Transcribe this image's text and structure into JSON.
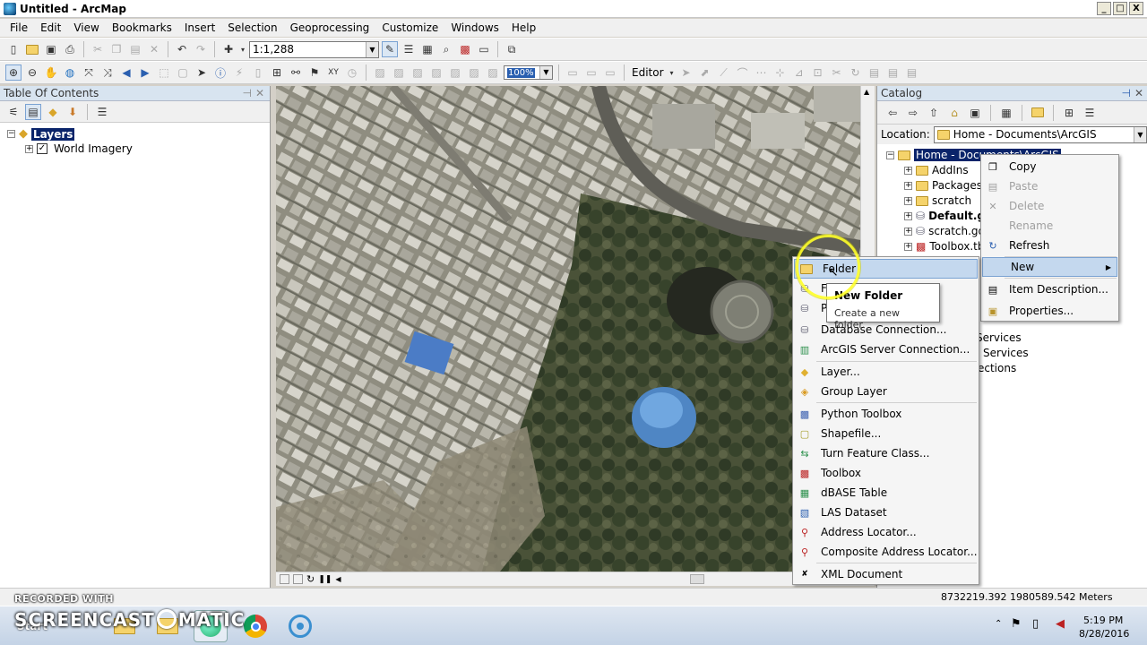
{
  "window": {
    "title": "Untitled - ArcMap",
    "min": "_",
    "max": "□",
    "close": "X"
  },
  "menu": [
    "File",
    "Edit",
    "View",
    "Bookmarks",
    "Insert",
    "Selection",
    "Geoprocessing",
    "Customize",
    "Windows",
    "Help"
  ],
  "toolbar": {
    "scale": "1:1,288",
    "opacity": "100%",
    "editor": "Editor"
  },
  "toc": {
    "title": "Table Of Contents",
    "layers_label": "Layers",
    "layer_name": "World Imagery",
    "layer_checked": "✓"
  },
  "catalog": {
    "title": "Catalog",
    "location_label": "Location:",
    "location_value": "Home - Documents\\ArcGIS",
    "tree_root": "Home - Documents\\ArcGIS",
    "tree_items": [
      "AddIns",
      "Packages",
      "scratch",
      "Default.g",
      "scratch.gd",
      "Toolbox.tb"
    ],
    "other_items": [
      "Services",
      "Services",
      "ections"
    ]
  },
  "context_menu": {
    "items": [
      {
        "label": "Copy",
        "disabled": false
      },
      {
        "label": "Paste",
        "disabled": true
      },
      {
        "label": "Delete",
        "disabled": true
      },
      {
        "label": "Rename",
        "disabled": true
      },
      {
        "label": "Refresh",
        "disabled": false
      },
      {
        "label": "New",
        "disabled": false
      },
      {
        "label": "Item Description...",
        "disabled": false
      },
      {
        "label": "Properties...",
        "disabled": false
      }
    ],
    "submenu_arrow": "▶"
  },
  "new_submenu": {
    "items": [
      "Folder",
      "Fi",
      "Pe",
      "Database Connection...",
      "ArcGIS Server Connection...",
      "Layer...",
      "Group Layer",
      "Python Toolbox",
      "Shapefile...",
      "Turn Feature Class...",
      "Toolbox",
      "dBASE Table",
      "LAS Dataset",
      "Address Locator...",
      "Composite Address Locator...",
      "XML Document"
    ]
  },
  "tooltip": {
    "title": "New Folder",
    "text": "Create a new folder."
  },
  "status": {
    "coords": "8732219.392  1980589.542 Meters"
  },
  "taskbar": {
    "start": "Start",
    "time": "5:19 PM",
    "date": "8/28/2016"
  },
  "watermark": {
    "line1": "RECORDED WITH",
    "line2": "SCREENCAST",
    "line3": "MATIC"
  }
}
